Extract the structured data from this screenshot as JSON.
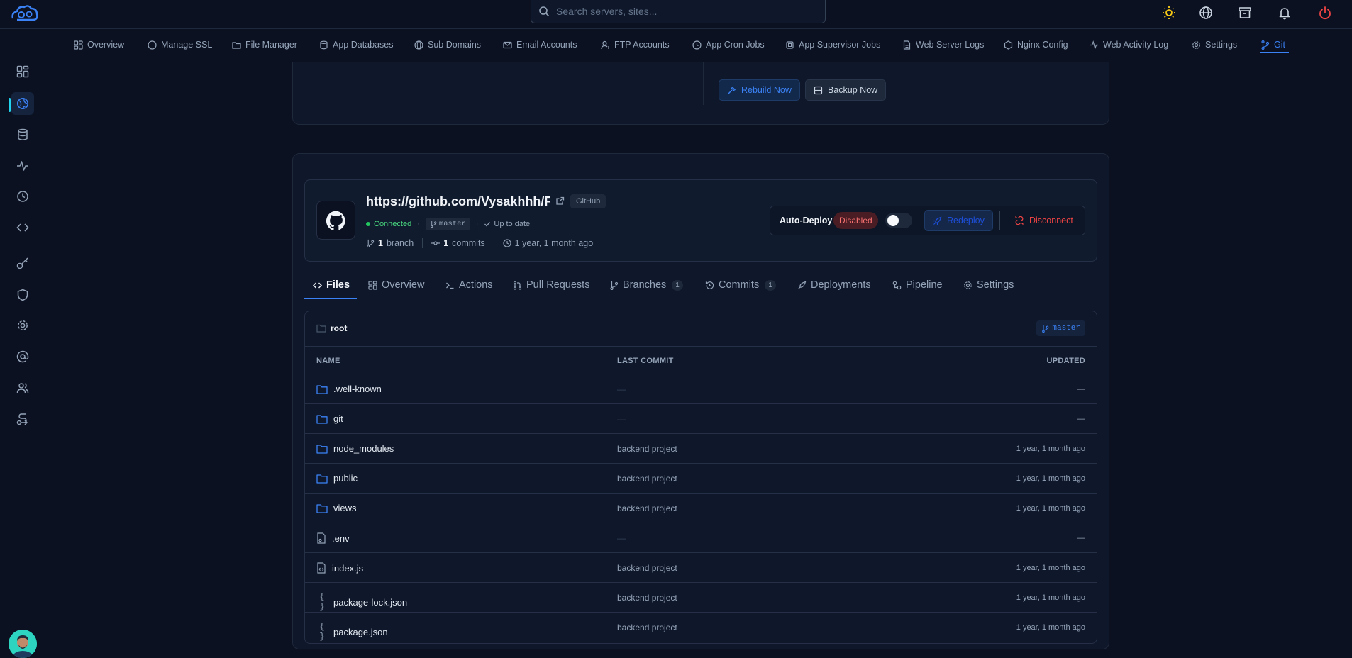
{
  "search": {
    "placeholder": "Search servers, sites..."
  },
  "nav": {
    "tabs": [
      {
        "label": "Overview"
      },
      {
        "label": "Manage SSL"
      },
      {
        "label": "File Manager"
      },
      {
        "label": "App Databases"
      },
      {
        "label": "Sub Domains"
      },
      {
        "label": "Email Accounts"
      },
      {
        "label": "FTP Accounts"
      },
      {
        "label": "App Cron Jobs"
      },
      {
        "label": "App Supervisor Jobs"
      },
      {
        "label": "Web Server Logs"
      },
      {
        "label": "Nginx Config"
      },
      {
        "label": "Web Activity Log"
      },
      {
        "label": "Settings"
      },
      {
        "label": "Git"
      }
    ],
    "active": "Git"
  },
  "top_actions": {
    "rebuild_label": "Rebuild Now",
    "backup_label": "Backup Now"
  },
  "repo": {
    "url": "https://github.com/Vysakhhh/F",
    "provider_badge": "GitHub",
    "status": "Connected",
    "branch": "master",
    "sync_status": "Up to date",
    "branch_count": "1",
    "branch_label": "branch",
    "commit_count": "1",
    "commit_label": "commits",
    "last_updated": "1 year, 1 month ago",
    "auto_deploy_label": "Auto-Deploy",
    "auto_deploy_status": "Disabled",
    "auto_deploy_enabled": false,
    "redeploy_label": "Redeploy",
    "disconnect_label": "Disconnect"
  },
  "tabs": [
    {
      "label": "Files",
      "count": ""
    },
    {
      "label": "Overview",
      "count": ""
    },
    {
      "label": "Actions",
      "count": ""
    },
    {
      "label": "Pull Requests",
      "count": ""
    },
    {
      "label": "Branches",
      "count": "1"
    },
    {
      "label": "Commits",
      "count": "1"
    },
    {
      "label": "Deployments",
      "count": ""
    },
    {
      "label": "Pipeline",
      "count": ""
    },
    {
      "label": "Settings",
      "count": ""
    }
  ],
  "files": {
    "path": "root",
    "branch": "master",
    "columns": {
      "name": "NAME",
      "commit": "LAST COMMIT",
      "updated": "UPDATED"
    },
    "rows": [
      {
        "name": ".well-known",
        "type": "folder",
        "commit": "—",
        "updated": "—"
      },
      {
        "name": "git",
        "type": "folder",
        "commit": "—",
        "updated": "—"
      },
      {
        "name": "node_modules",
        "type": "folder",
        "commit": "backend project",
        "updated": "1 year, 1 month ago"
      },
      {
        "name": "public",
        "type": "folder",
        "commit": "backend project",
        "updated": "1 year, 1 month ago"
      },
      {
        "name": "views",
        "type": "folder",
        "commit": "backend project",
        "updated": "1 year, 1 month ago"
      },
      {
        "name": ".env",
        "type": "file-env",
        "commit": "—",
        "updated": "—"
      },
      {
        "name": "index.js",
        "type": "file-code",
        "commit": "backend project",
        "updated": "1 year, 1 month ago"
      },
      {
        "name": "package-lock.json",
        "type": "json",
        "commit": "backend project",
        "updated": "1 year, 1 month ago"
      },
      {
        "name": "package.json",
        "type": "json",
        "commit": "backend project",
        "updated": "1 year, 1 month ago"
      }
    ]
  },
  "colors": {
    "accent": "#3b82f6",
    "danger": "#ef4444",
    "success": "#22c55e",
    "background": "#0b1120"
  }
}
